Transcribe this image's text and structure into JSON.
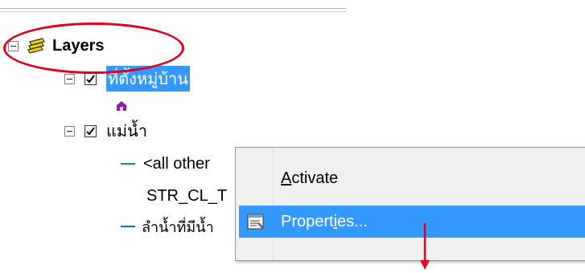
{
  "toc": {
    "root_label": "Layers",
    "layer1_label": "ที่ตั้งหมู่บ้าน",
    "layer2_label": "แม่น้ำ",
    "legend_all_other": "<all other",
    "legend_field": "STR_CL_T",
    "legend_water": "ลำน้ำที่มีน้ำ"
  },
  "context_menu": {
    "items": [
      {
        "label": "Activate",
        "mnemonic": "A"
      },
      {
        "label": "Properties...",
        "mnemonic": "i"
      }
    ]
  },
  "colors": {
    "selection": "#3399ff",
    "highlight_ellipse": "#e3001b",
    "arrow": "#e3001b",
    "layers_icon": "#f2d600",
    "village_symbol": "#8b1fa6",
    "legend_green": "#1a9a3a",
    "legend_blue": "#1f5fd6"
  }
}
